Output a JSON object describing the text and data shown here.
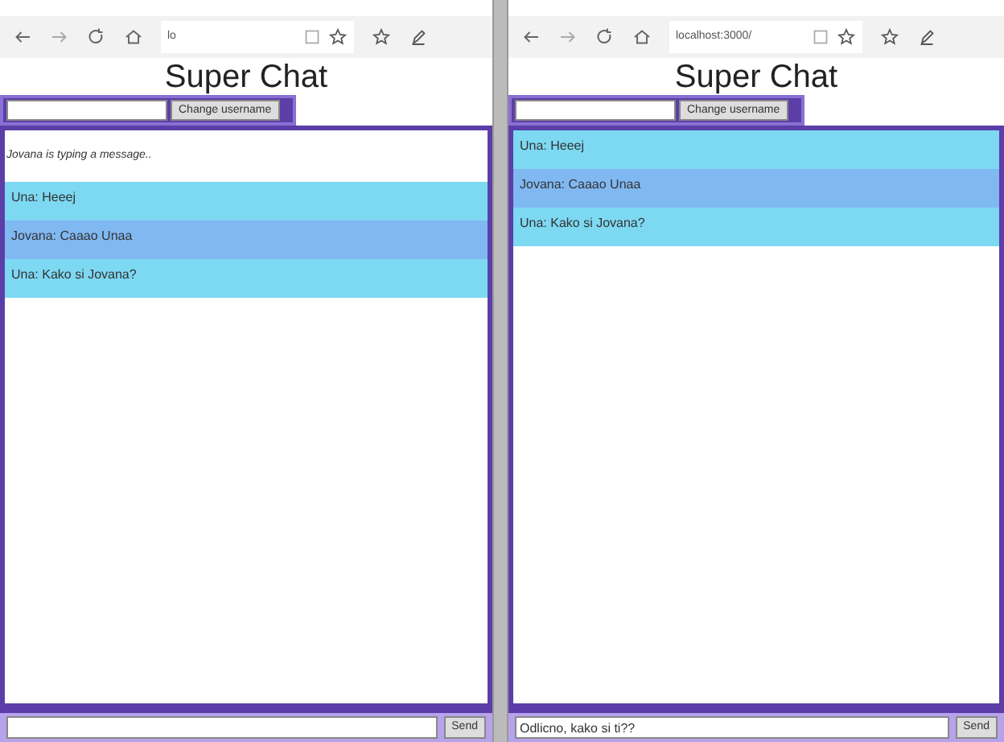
{
  "windows": [
    {
      "address": "lo",
      "title": "Super Chat",
      "username_button": "Change username",
      "typing": "Jovana is typing a message..",
      "messages": [
        {
          "text": "Una: Heeej",
          "color": "#7dd8f2"
        },
        {
          "text": "Jovana: Caaao Unaa",
          "color": "#80b8f2"
        },
        {
          "text": "Una: Kako si Jovana?",
          "color": "#7dd8f2"
        }
      ],
      "send_button": "Send"
    },
    {
      "address": "localhost:3000/",
      "title": "Super Chat",
      "username_button": "Change username",
      "messages": [
        {
          "text": "Una: Heeej",
          "color": "#7dd8f2"
        },
        {
          "text": "Jovana: Caaao Unaa",
          "color": "#80b8f2"
        },
        {
          "text": "Una: Kako si Jovana?",
          "color": "#7dd8f2"
        }
      ],
      "message_input": {
        "value": "Odlicno, kako si ti??"
      },
      "send_button": "Send"
    }
  ]
}
